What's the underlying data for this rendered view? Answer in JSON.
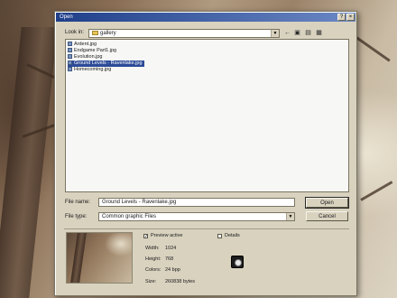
{
  "dialog": {
    "title": "Open",
    "title_buttons": [
      "?",
      "×"
    ]
  },
  "lookin": {
    "label": "Look in:",
    "value": "gallery"
  },
  "toolbar": {
    "icons": [
      "back-icon",
      "up-folder-icon",
      "new-folder-icon",
      "view-menu-icon"
    ]
  },
  "files": [
    {
      "name": "Ardent.jpg",
      "selected": false
    },
    {
      "name": "Endgame Part1.jpg",
      "selected": false
    },
    {
      "name": "Evolution.jpg",
      "selected": false
    },
    {
      "name": "Ground Levels - Ravenlake.jpg",
      "selected": true
    },
    {
      "name": "Homecoming.jpg",
      "selected": false
    }
  ],
  "filename": {
    "label": "File name:",
    "value": "Ground Levels - Ravenlake.jpg"
  },
  "filetype": {
    "label": "File type:",
    "value": "Common graphic Files"
  },
  "buttons": {
    "open": "Open",
    "cancel": "Cancel"
  },
  "preview": {
    "active_label": "Preview active",
    "active_checked": true,
    "details_label": "Details",
    "details_checked": false,
    "width_label": "Width:",
    "width_value": "1024",
    "height_label": "Height:",
    "height_value": "768",
    "colors_label": "Colors:",
    "colors_value": "24 bpp",
    "size_label": "Size:",
    "size_value": "260838 bytes"
  }
}
